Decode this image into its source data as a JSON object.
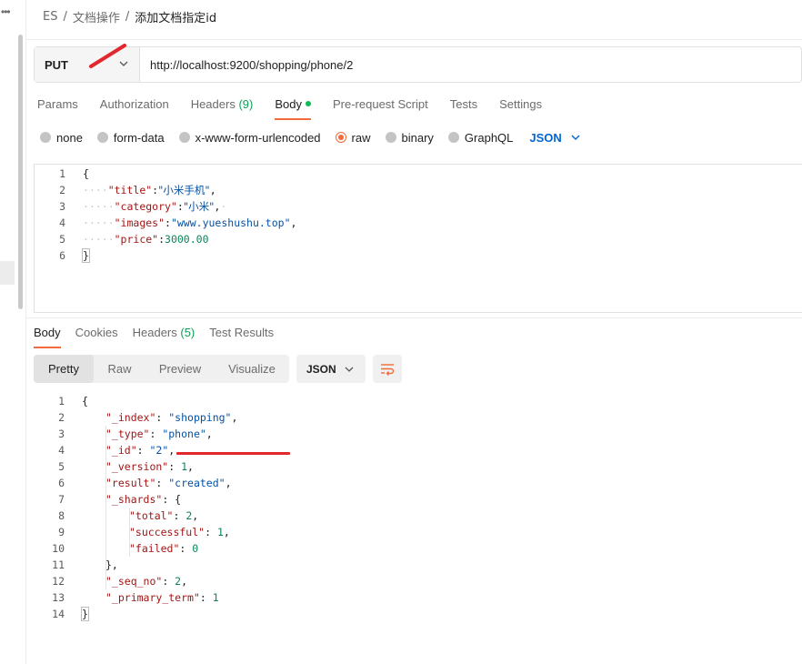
{
  "left_strip": {
    "more_icon": "more-horizontal-icon"
  },
  "breadcrumb": {
    "root": "ES",
    "folder": "文档操作",
    "current": "添加文档指定id",
    "separator": "/"
  },
  "request": {
    "method": "PUT",
    "url": "http://localhost:9200/shopping/phone/2"
  },
  "request_tabs": [
    {
      "label": "Params"
    },
    {
      "label": "Authorization"
    },
    {
      "label": "Headers",
      "count": "(9)"
    },
    {
      "label": "Body",
      "active": true,
      "indicator": "dot"
    },
    {
      "label": "Pre-request Script"
    },
    {
      "label": "Tests"
    },
    {
      "label": "Settings"
    }
  ],
  "body_types": [
    {
      "label": "none"
    },
    {
      "label": "form-data"
    },
    {
      "label": "x-www-form-urlencoded"
    },
    {
      "label": "raw",
      "selected": true
    },
    {
      "label": "binary"
    },
    {
      "label": "GraphQL"
    }
  ],
  "body_format": "JSON",
  "request_body": [
    {
      "n": "1",
      "tokens": [
        [
          "p",
          "{"
        ]
      ]
    },
    {
      "n": "2",
      "tokens": [
        [
          "ws",
          "····"
        ],
        [
          "k",
          "\"title\""
        ],
        [
          "p",
          ":"
        ],
        [
          "s",
          "\"小米手机\""
        ],
        [
          "p",
          ","
        ]
      ]
    },
    {
      "n": "3",
      "tokens": [
        [
          "ws",
          "·····"
        ],
        [
          "k",
          "\"category\""
        ],
        [
          "p",
          ":"
        ],
        [
          "s",
          "\"小米\""
        ],
        [
          "p",
          ","
        ],
        [
          "ws",
          "·"
        ]
      ]
    },
    {
      "n": "4",
      "tokens": [
        [
          "ws",
          "·····"
        ],
        [
          "k",
          "\"images\""
        ],
        [
          "p",
          ":"
        ],
        [
          "s",
          "\"www.yueshushu.top\""
        ],
        [
          "p",
          ","
        ]
      ]
    },
    {
      "n": "5",
      "tokens": [
        [
          "ws",
          "·····"
        ],
        [
          "k",
          "\"price\""
        ],
        [
          "p",
          ":"
        ],
        [
          "n",
          "3000.00"
        ]
      ]
    },
    {
      "n": "6",
      "tokens": [
        [
          "p",
          "}"
        ]
      ]
    }
  ],
  "response_tabs": [
    {
      "label": "Body",
      "active": true
    },
    {
      "label": "Cookies"
    },
    {
      "label": "Headers",
      "count": "(5)"
    },
    {
      "label": "Test Results"
    }
  ],
  "view_modes": [
    "Pretty",
    "Raw",
    "Preview",
    "Visualize"
  ],
  "active_view": "Pretty",
  "response_format": "JSON",
  "response_body": [
    {
      "n": "1",
      "indent": 0,
      "tokens": [
        [
          "p",
          "{"
        ]
      ]
    },
    {
      "n": "2",
      "indent": 1,
      "tokens": [
        [
          "k",
          "\"_index\""
        ],
        [
          "p",
          ": "
        ],
        [
          "s",
          "\"shopping\""
        ],
        [
          "p",
          ","
        ]
      ]
    },
    {
      "n": "3",
      "indent": 1,
      "tokens": [
        [
          "k",
          "\"_type\""
        ],
        [
          "p",
          ": "
        ],
        [
          "s",
          "\"phone\""
        ],
        [
          "p",
          ","
        ]
      ]
    },
    {
      "n": "4",
      "indent": 1,
      "tokens": [
        [
          "k",
          "\"_id\""
        ],
        [
          "p",
          ": "
        ],
        [
          "s",
          "\"2\""
        ],
        [
          "p",
          ","
        ]
      ]
    },
    {
      "n": "5",
      "indent": 1,
      "tokens": [
        [
          "k",
          "\"_version\""
        ],
        [
          "p",
          ": "
        ],
        [
          "n",
          "1"
        ],
        [
          "p",
          ","
        ]
      ]
    },
    {
      "n": "6",
      "indent": 1,
      "tokens": [
        [
          "k",
          "\"result\""
        ],
        [
          "p",
          ": "
        ],
        [
          "s",
          "\"created\""
        ],
        [
          "p",
          ","
        ]
      ]
    },
    {
      "n": "7",
      "indent": 1,
      "tokens": [
        [
          "k",
          "\"_shards\""
        ],
        [
          "p",
          ": {"
        ]
      ]
    },
    {
      "n": "8",
      "indent": 2,
      "tokens": [
        [
          "k",
          "\"total\""
        ],
        [
          "p",
          ": "
        ],
        [
          "n",
          "2"
        ],
        [
          "p",
          ","
        ]
      ]
    },
    {
      "n": "9",
      "indent": 2,
      "tokens": [
        [
          "k",
          "\"successful\""
        ],
        [
          "p",
          ": "
        ],
        [
          "n",
          "1"
        ],
        [
          "p",
          ","
        ]
      ]
    },
    {
      "n": "10",
      "indent": 2,
      "tokens": [
        [
          "k",
          "\"failed\""
        ],
        [
          "p",
          ": "
        ],
        [
          "n",
          "0"
        ]
      ]
    },
    {
      "n": "11",
      "indent": 1,
      "tokens": [
        [
          "p",
          "},"
        ]
      ]
    },
    {
      "n": "12",
      "indent": 1,
      "tokens": [
        [
          "k",
          "\"_seq_no\""
        ],
        [
          "p",
          ": "
        ],
        [
          "n",
          "2"
        ],
        [
          "p",
          ","
        ]
      ]
    },
    {
      "n": "13",
      "indent": 1,
      "tokens": [
        [
          "k",
          "\"_primary_term\""
        ],
        [
          "p",
          ": "
        ],
        [
          "n",
          "1"
        ]
      ]
    },
    {
      "n": "14",
      "indent": 0,
      "tokens": [
        [
          "p",
          "}"
        ]
      ]
    }
  ],
  "colors": {
    "accent": "#f26b3a",
    "json_key": "#a31515",
    "json_string": "#0451a5",
    "json_number": "#098658",
    "annotation_red": "#e0282e",
    "format_blue": "#0265d2"
  }
}
